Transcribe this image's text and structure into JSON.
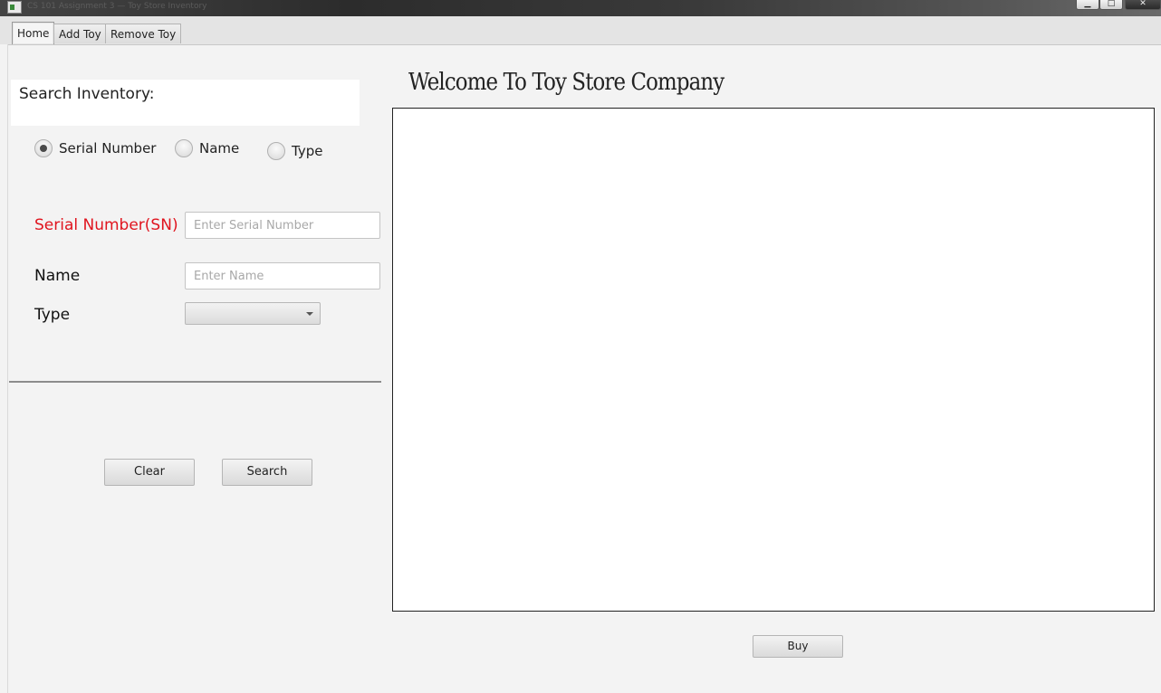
{
  "window": {
    "title": "CS 101 Assignment 3 — Toy Store Inventory",
    "controls": {
      "minimize": "▁",
      "maximize": "□",
      "close": "✕"
    }
  },
  "tabs": [
    {
      "label": "Home",
      "active": true
    },
    {
      "label": "Add Toy",
      "active": false
    },
    {
      "label": "Remove Toy",
      "active": false
    }
  ],
  "search": {
    "heading": "Search Inventory:",
    "options": [
      {
        "label": "Serial Number",
        "checked": true
      },
      {
        "label": "Name",
        "checked": false
      },
      {
        "label": "Type",
        "checked": false
      }
    ],
    "fields": {
      "serial_label": "Serial Number(SN)",
      "serial_placeholder": "Enter Serial Number",
      "serial_value": "",
      "name_label": "Name",
      "name_placeholder": "Enter Name",
      "name_value": "",
      "type_label": "Type",
      "type_selected": ""
    },
    "clear_label": "Clear",
    "search_label": "Search"
  },
  "main": {
    "welcome": "Welcome To Toy Store Company",
    "buy_label": "Buy"
  },
  "colors": {
    "required_label": "#e0141e",
    "background": "#f3f3f3"
  }
}
